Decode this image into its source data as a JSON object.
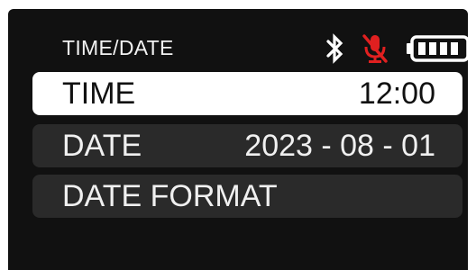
{
  "header": {
    "title": "TIME/DATE",
    "icons": [
      "bluetooth-icon",
      "mic-muted-icon",
      "battery-icon"
    ],
    "mic_color": "#e02020",
    "battery_level": 1.0
  },
  "menu": {
    "items": [
      {
        "label": "TIME",
        "value": "12:00",
        "selected": true
      },
      {
        "label": "DATE",
        "value": "2023 - 08 - 01",
        "selected": false
      },
      {
        "label": "DATE FORMAT",
        "value": "",
        "selected": false
      }
    ]
  },
  "colors": {
    "screen_bg": "#111111",
    "selected_bg": "#ffffff",
    "item_bg": "#2a2a2a",
    "text": "#f0f0f0",
    "accent_red": "#e02020"
  }
}
